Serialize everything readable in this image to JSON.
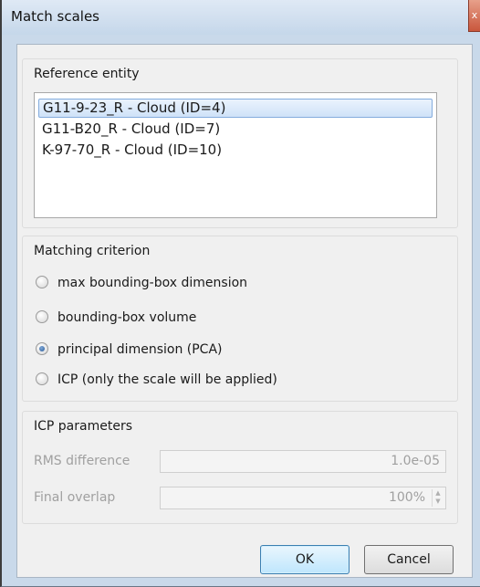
{
  "window": {
    "title": "Match scales",
    "close_glyph": "x"
  },
  "reference_entity": {
    "group_title": "Reference entity",
    "items": [
      {
        "label": "G11-9-23_R - Cloud (ID=4)",
        "selected": true
      },
      {
        "label": "G11-B20_R - Cloud (ID=7)",
        "selected": false
      },
      {
        "label": "K-97-70_R - Cloud (ID=10)",
        "selected": false
      }
    ]
  },
  "matching_criterion": {
    "group_title": "Matching criterion",
    "options": [
      {
        "label": "max bounding-box dimension",
        "checked": false
      },
      {
        "label": "bounding-box volume",
        "checked": false
      },
      {
        "label": "principal dimension (PCA)",
        "checked": true
      },
      {
        "label": "ICP (only the scale will be applied)",
        "checked": false
      }
    ]
  },
  "icp_parameters": {
    "group_title": "ICP parameters",
    "rms_label": "RMS difference",
    "rms_value": "1.0e-05",
    "overlap_label": "Final overlap",
    "overlap_value": "100%",
    "enabled": false
  },
  "buttons": {
    "ok": "OK",
    "cancel": "Cancel"
  }
}
